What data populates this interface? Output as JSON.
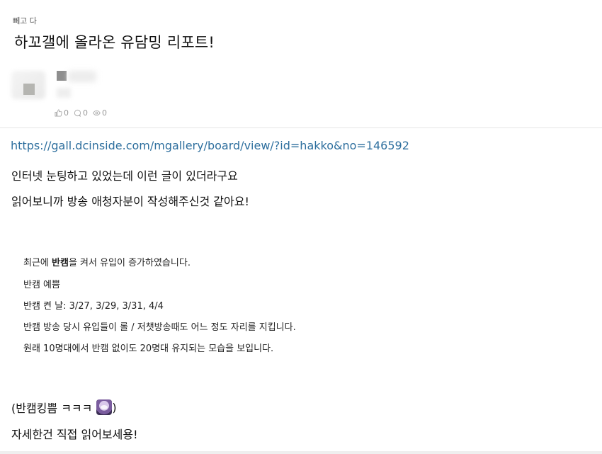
{
  "post": {
    "category": "뻬고 다",
    "title": "하꼬갤에 올라온 유담밍 리포트!",
    "stats": {
      "likes": "0",
      "comments": "0",
      "views": "0"
    }
  },
  "body": {
    "link": "https://gall.dcinside.com/mgallery/board/view/?id=hakko&no=146592",
    "p1": "인터넷 눈팅하고 있었는데 이런 글이 있더라구요",
    "p2": "읽어보니까 방송 애청자분이 작성해주신것 같아요!",
    "quote": {
      "l1_pre": "최근에 ",
      "l1_bold": "반캠",
      "l1_post": "을 켜서 유입이 증가하였습니다.",
      "l2": "반캠 예쁨",
      "l3": "반캠 켠 날: 3/27, 3/29, 3/31, 4/4",
      "l4": "반캠 방송 당시 유입들이 롤 / 저챗방송때도 어느 정도 자리를 지킵니다.",
      "l5": "원래 10명대에서 반캠 없이도 20명대 유지되는 모습을 보입니다."
    },
    "p3_pre": "(반캠킹쁨 ㅋㅋㅋ",
    "p3_post": ")",
    "p4": "자세한건 직접 읽어보세용!"
  }
}
